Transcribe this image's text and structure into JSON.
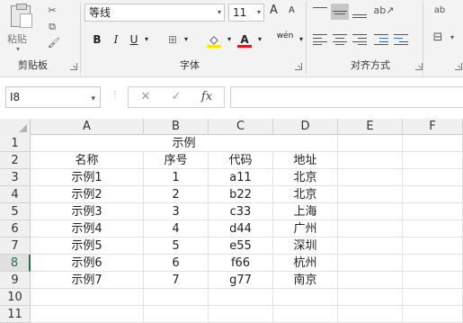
{
  "ribbon": {
    "clipboard": {
      "label": "剪贴板",
      "paste_label": "粘贴",
      "paste_arrow": "▾"
    },
    "font": {
      "label": "字体",
      "font_name": "等线",
      "font_size": "11",
      "bold": "B",
      "italic": "I",
      "underline": "U",
      "grow": "A",
      "shrink": "A",
      "pinyin": "wén",
      "highlight_color": "#ffe600",
      "font_color": "#e81123"
    },
    "alignment": {
      "label": "对齐方式"
    },
    "wrap_icon_text": "ab"
  },
  "formula_bar": {
    "name_box": "I8",
    "cancel_icon": "✕",
    "enter_icon": "✓",
    "fx_label": "fx",
    "formula": ""
  },
  "grid": {
    "columns": [
      "A",
      "B",
      "C",
      "D",
      "E",
      "F"
    ],
    "rows": [
      "1",
      "2",
      "3",
      "4",
      "5",
      "6",
      "7",
      "8",
      "9",
      "10",
      "11"
    ],
    "selected_row": "8",
    "title": "示例",
    "header": [
      "名称",
      "序号",
      "代码",
      "地址"
    ],
    "data": [
      [
        "示例1",
        "1",
        "a11",
        "北京"
      ],
      [
        "示例2",
        "2",
        "b22",
        "北京"
      ],
      [
        "示例3",
        "3",
        "c33",
        "上海"
      ],
      [
        "示例4",
        "4",
        "d44",
        "广州"
      ],
      [
        "示例5",
        "5",
        "e55",
        "深圳"
      ],
      [
        "示例6",
        "6",
        "f66",
        "杭州"
      ],
      [
        "示例7",
        "7",
        "g77",
        "南京"
      ]
    ],
    "accent_color": "#217346"
  }
}
